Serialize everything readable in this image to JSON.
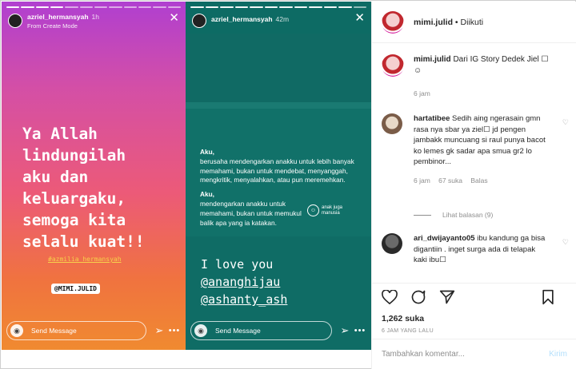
{
  "story1": {
    "username": "azriel_hermansyah",
    "time": "1h",
    "subtitle": "From Create Mode",
    "main_text": [
      "Ya Allah",
      "lindungilah",
      "aku dan",
      "keluargaku,",
      "semoga kita",
      "selalu kuat!!"
    ],
    "hashtag": "#azmilia_hermansyah",
    "mention": "@MIMI.JULID",
    "message_placeholder": "Send Message"
  },
  "story2": {
    "username": "azriel_hermansyah",
    "time": "42m",
    "paragraph1_title": "Aku,",
    "paragraph1": "berusaha mendengarkan anakku untuk lebih banyak memahami, bukan untuk mendebat, menyanggah, mengkritik, menyalahkan, atau pun meremehkan.",
    "paragraph2_title": "Aku,",
    "paragraph2": "mendengarkan anakku untuk memahami, bukan untuk memukul balik apa yang ia katakan.",
    "logo_text": [
      "anak juga",
      "manusia"
    ],
    "love_text": "I love you",
    "mention1": "@ananghijau",
    "mention2": "@ashanty_ash",
    "message_placeholder": "Send Message"
  },
  "post": {
    "username": "mimi.julid",
    "follow_status": "Diikuti",
    "caption_user": "mimi.julid",
    "caption_text": "Dari IG Story Dedek Jiel ☐",
    "caption_emoji": "☺",
    "caption_time": "6 jam"
  },
  "comments": [
    {
      "user": "hartatibee",
      "text": "Sedih aing ngerasain gmn rasa nya sbar ya ziel☐ jd pengen jambakk muncuang si raul punya bacot ko lemes gk sadar apa smua gr2 lo pembinor...",
      "time": "6 jam",
      "likes": "67 suka",
      "reply": "Balas",
      "view_replies": "Lihat balasan (9)"
    },
    {
      "user": "ari_dwijayanto05",
      "text": "ibu kandung ga bisa digantiin . inget surga ada di telapak kaki ibu☐"
    }
  ],
  "actions": {
    "likes_count": "1,262 suka",
    "time_ago": "6 JAM YANG LALU",
    "comment_placeholder": "Tambahkan komentar...",
    "post_label": "Kirim"
  },
  "colors": {
    "story1_gradient": [
      "#b03fd0",
      "#ec5a78",
      "#f08a30"
    ],
    "story2_bg": "#0f6d66",
    "post_button": "#b2dffc"
  }
}
